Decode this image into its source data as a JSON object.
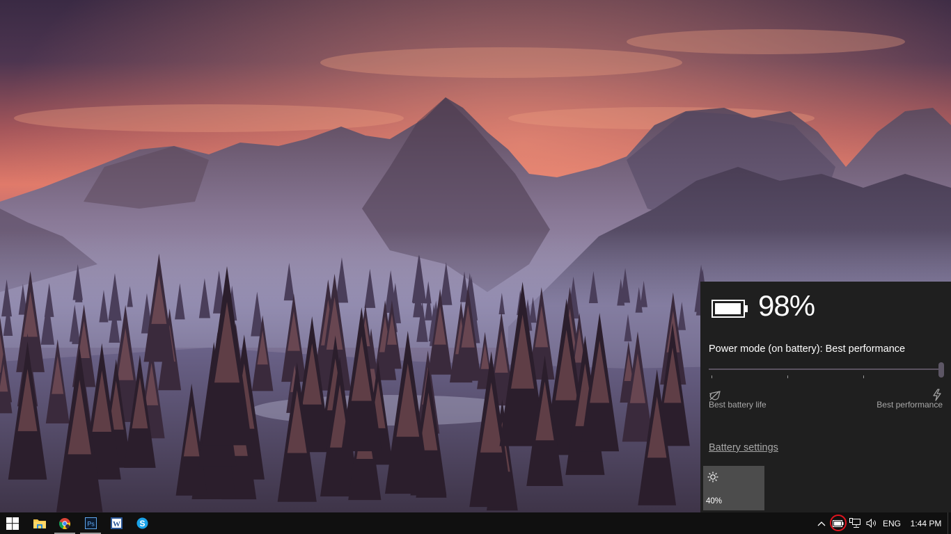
{
  "desktop": {
    "wallpaper": "snowy-mountains-sunset",
    "colors": {
      "sky_dark": "#3b2c48",
      "sky_glow": "#e07a6a",
      "mountain": "#6a5e78",
      "snow": "#c9c6d8",
      "forest": "#2b2030"
    }
  },
  "battery_flyout": {
    "battery_percent_label": "98%",
    "battery_level_fraction": 0.98,
    "power_mode_label": "Power mode (on battery): Best performance",
    "power_slider": {
      "position_fraction": 1.0,
      "steps": 4,
      "selected_step": 4,
      "min_label": "Best battery life",
      "max_label": "Best performance"
    },
    "battery_settings_link": "Battery settings",
    "brightness_tile": {
      "icon": "sun-icon",
      "value_label": "40%"
    },
    "colors": {
      "background": "#1f1f1f",
      "tile": "#4c4c4c",
      "muted_text": "#a8a8a8"
    }
  },
  "taskbar": {
    "start_icon": "windows-logo-icon",
    "apps": [
      {
        "name": "File Explorer",
        "icon": "folder-icon",
        "running": false
      },
      {
        "name": "Google Chrome",
        "icon": "chrome-icon",
        "running": true
      },
      {
        "name": "Adobe Photoshop",
        "icon": "photoshop-icon",
        "label": "Ps",
        "running": true
      },
      {
        "name": "Microsoft Word",
        "icon": "word-icon",
        "label": "W",
        "running": false
      },
      {
        "name": "Skype",
        "icon": "skype-icon",
        "label": "S",
        "running": false
      }
    ],
    "tray": {
      "chevron": "show-hidden-icons",
      "battery_icon": "battery-icon",
      "network_icon": "network-icon",
      "volume_icon": "volume-icon",
      "language": "ENG",
      "time": "1:44 PM"
    },
    "highlight_color": "#e0141e"
  }
}
